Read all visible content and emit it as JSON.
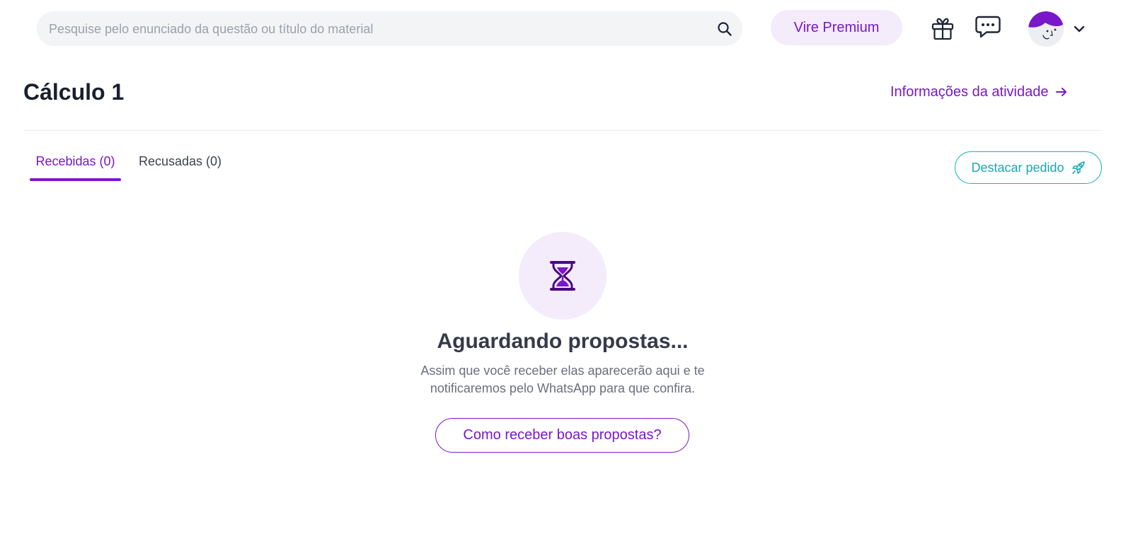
{
  "header": {
    "search": {
      "placeholder": "Pesquise pelo enunciado da questão ou título do material",
      "value": "",
      "icon": "search-icon"
    },
    "premium_label": "Vire Premium",
    "icons": [
      "gift-icon",
      "chat-icon",
      "avatar",
      "chevron-down-icon"
    ]
  },
  "page": {
    "title": "Cálculo 1",
    "info_link": "Informações da atividade"
  },
  "tabs": [
    {
      "label": "Recebidas (0)",
      "active": true
    },
    {
      "label": "Recusadas (0)",
      "active": false
    }
  ],
  "highlight_button": "Destacar pedido",
  "empty_state": {
    "icon": "hourglass-icon",
    "title": "Aguardando propostas...",
    "description_line1": "Assim que você receber elas aparecerão aqui e te",
    "description_line2": "notificaremos pelo WhatsApp para que confira.",
    "button": "Como receber boas propostas?"
  },
  "colors": {
    "accent": "#7a17c9",
    "accent_light": "#f4ebfb",
    "teal": "#1fb3bd"
  }
}
